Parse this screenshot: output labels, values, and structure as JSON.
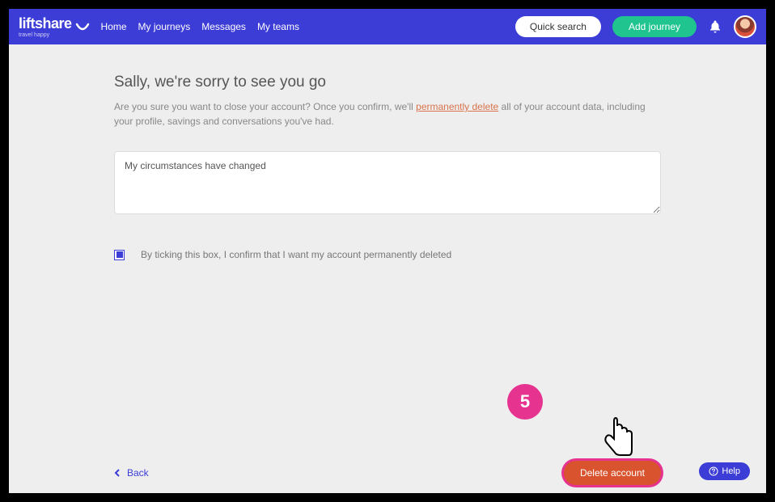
{
  "header": {
    "logo_text": "liftshare",
    "logo_tagline": "travel happy",
    "nav": [
      "Home",
      "My journeys",
      "Messages",
      "My teams"
    ],
    "quick_search_label": "Quick search",
    "add_journey_label": "Add journey"
  },
  "main": {
    "title": "Sally, we're sorry to see you go",
    "subtitle_before": "Are you sure you want to close your account? Once you confirm, we'll ",
    "subtitle_link": "permanently delete",
    "subtitle_after": " all of your account data, including your profile, savings and conversations you've had.",
    "textarea_value": "My circumstances have changed",
    "checkbox_checked": true,
    "checkbox_label": "By ticking this box, I confirm that I want my account permanently deleted"
  },
  "footer": {
    "back_label": "Back",
    "delete_label": "Delete account",
    "help_label": "Help"
  },
  "annotation": {
    "badge": "5"
  }
}
